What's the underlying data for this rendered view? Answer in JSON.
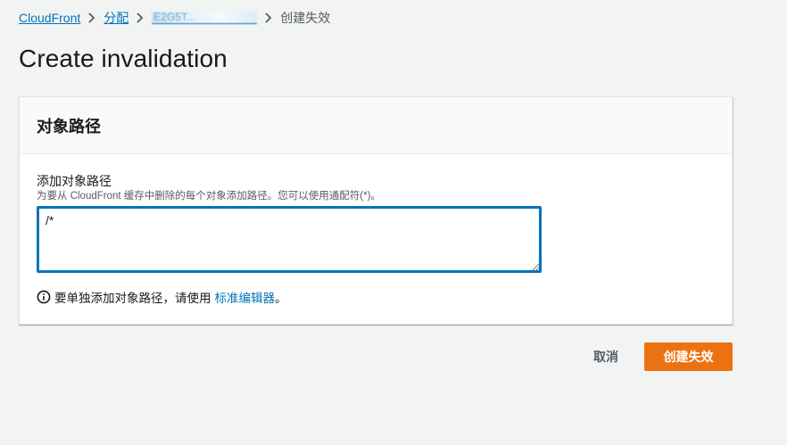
{
  "breadcrumb": {
    "items": [
      {
        "label": "CloudFront"
      },
      {
        "label": "分配"
      },
      {
        "label": "E2G5T..."
      },
      {
        "label": "创建失效"
      }
    ]
  },
  "page": {
    "title": "Create invalidation"
  },
  "panel": {
    "title": "对象路径",
    "field_label": "添加对象路径",
    "field_description": "为要从 CloudFront 缓存中删除的每个对象添加路径。您可以使用通配符(*)。",
    "path_value": "/*",
    "info_text": "要单独添加对象路径，请使用",
    "info_link": "标准编辑器",
    "info_suffix": "。"
  },
  "actions": {
    "cancel_label": "取消",
    "create_label": "创建失效"
  },
  "colors": {
    "link": "#0073bb",
    "primary": "#ec7211",
    "background": "#f2f3f3"
  },
  "icons": {
    "separator": "chevron-right-icon",
    "info": "info-circle-icon"
  }
}
